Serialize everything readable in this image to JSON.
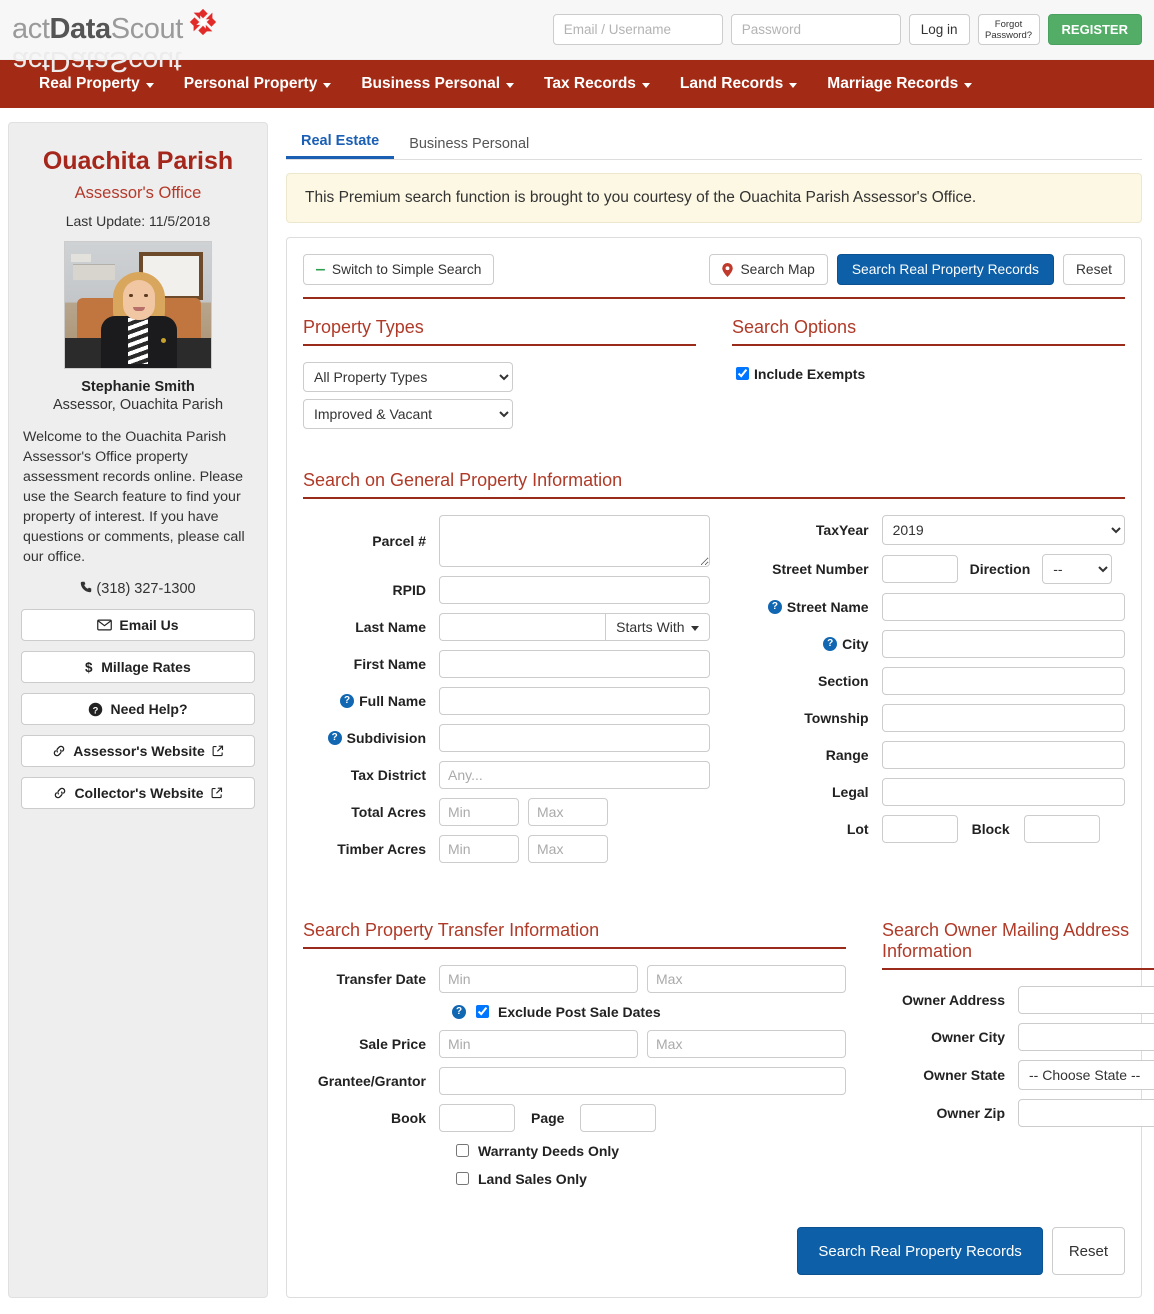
{
  "brand": {
    "name_prefix": "act",
    "name_bold": "Data",
    "name_suffix": "Scout",
    "icon": "pinwheel-icon"
  },
  "auth": {
    "username_placeholder": "Email / Username",
    "username_value": "",
    "password_placeholder": "Password",
    "password_value": "",
    "login_label": "Log in",
    "forgot_label": "Forgot Password?",
    "register_label": "REGISTER"
  },
  "nav": {
    "items": [
      {
        "label": "Real Property"
      },
      {
        "label": "Personal Property"
      },
      {
        "label": "Business Personal"
      },
      {
        "label": "Tax Records"
      },
      {
        "label": "Land Records"
      },
      {
        "label": "Marriage Records"
      }
    ]
  },
  "sidebar": {
    "title": "Ouachita Parish",
    "subtitle": "Assessor's Office",
    "last_update": "Last Update: 11/5/2018",
    "photo_alt": "assessor-portrait",
    "assessor_name": "Stephanie Smith",
    "assessor_role": "Assessor, Ouachita Parish",
    "welcome": "Welcome to the Ouachita Parish Assessor's Office property assessment records online. Please use the Search feature to find your property of interest. If you have questions or comments, please call our office.",
    "phone": "(318) 327-1300",
    "buttons": [
      {
        "label": "Email Us",
        "icon": "envelope-icon"
      },
      {
        "label": "Millage Rates",
        "icon": "dollar-icon"
      },
      {
        "label": "Need Help?",
        "icon": "question-circle-icon"
      },
      {
        "label": "Assessor's Website",
        "icon": "link-icon",
        "external": true
      },
      {
        "label": "Collector's Website",
        "icon": "link-icon",
        "external": true
      }
    ]
  },
  "tabs": [
    {
      "label": "Real Estate",
      "active": true
    },
    {
      "label": "Business Personal",
      "active": false
    }
  ],
  "notice": "This Premium search function is brought to you courtesy of the Ouachita Parish Assessor's Office.",
  "toolbar": {
    "switch_label": "Switch to Simple Search",
    "search_map_label": "Search Map",
    "search_records_label": "Search Real Property Records",
    "reset_label": "Reset"
  },
  "property_types": {
    "heading": "Property Types",
    "type_value": "All Property Types",
    "type_options": [
      "All Property Types"
    ],
    "status_value": "Improved & Vacant",
    "status_options": [
      "Improved & Vacant"
    ]
  },
  "search_options": {
    "heading": "Search Options",
    "include_exempts_label": "Include Exempts",
    "include_exempts_checked": true
  },
  "general": {
    "heading": "Search on General Property Information",
    "left": {
      "parcel_label": "Parcel #",
      "parcel_value": "",
      "rpid_label": "RPID",
      "rpid_value": "",
      "last_name_label": "Last Name",
      "last_name_value": "",
      "last_name_match": "Starts With",
      "first_name_label": "First Name",
      "first_name_value": "",
      "full_name_label": "Full Name",
      "full_name_value": "",
      "subdivision_label": "Subdivision",
      "subdivision_value": "",
      "tax_district_label": "Tax District",
      "tax_district_value": "Any...",
      "total_acres_label": "Total Acres",
      "total_acres_min": "Min",
      "total_acres_max": "Max",
      "timber_acres_label": "Timber Acres",
      "timber_acres_min": "Min",
      "timber_acres_max": "Max"
    },
    "right": {
      "tax_year_label": "TaxYear",
      "tax_year_value": "2019",
      "tax_year_options": [
        "2019"
      ],
      "street_number_label": "Street Number",
      "street_number_value": "",
      "direction_label": "Direction",
      "direction_value": "--",
      "direction_options": [
        "--"
      ],
      "street_name_label": "Street Name",
      "street_name_value": "",
      "city_label": "City",
      "city_value": "",
      "section_label": "Section",
      "section_value": "",
      "township_label": "Township",
      "township_value": "",
      "range_label": "Range",
      "range_value": "",
      "legal_label": "Legal",
      "legal_value": "",
      "lot_label": "Lot",
      "lot_value": "",
      "block_label": "Block",
      "block_value": ""
    }
  },
  "transfer": {
    "heading": "Search Property Transfer Information",
    "transfer_date_label": "Transfer Date",
    "transfer_date_min": "Min",
    "transfer_date_max": "Max",
    "exclude_post_sale_label": "Exclude Post Sale Dates",
    "exclude_post_sale_checked": true,
    "sale_price_label": "Sale Price",
    "sale_price_min": "Min",
    "sale_price_max": "Max",
    "grantee_label": "Grantee/Grantor",
    "grantee_value": "",
    "book_label": "Book",
    "book_value": "",
    "page_label": "Page",
    "page_value": "",
    "warranty_deeds_label": "Warranty Deeds Only",
    "warranty_deeds_checked": false,
    "land_sales_label": "Land Sales Only",
    "land_sales_checked": false
  },
  "owner": {
    "heading": "Search Owner Mailing Address Information",
    "address_label": "Owner Address",
    "address_value": "",
    "city_label": "Owner City",
    "city_value": "",
    "state_label": "Owner State",
    "state_value": "-- Choose State --",
    "state_options": [
      "-- Choose State --"
    ],
    "zip_label": "Owner Zip",
    "zip_value": ""
  },
  "footer_actions": {
    "search_label": "Search Real Property Records",
    "reset_label": "Reset"
  },
  "colors": {
    "nav_red": "#a32a14",
    "heading_red": "#b03a28",
    "accent_blue": "#0d5fa8",
    "register_green": "#53ad67",
    "notice_bg": "#fdf8e3"
  }
}
